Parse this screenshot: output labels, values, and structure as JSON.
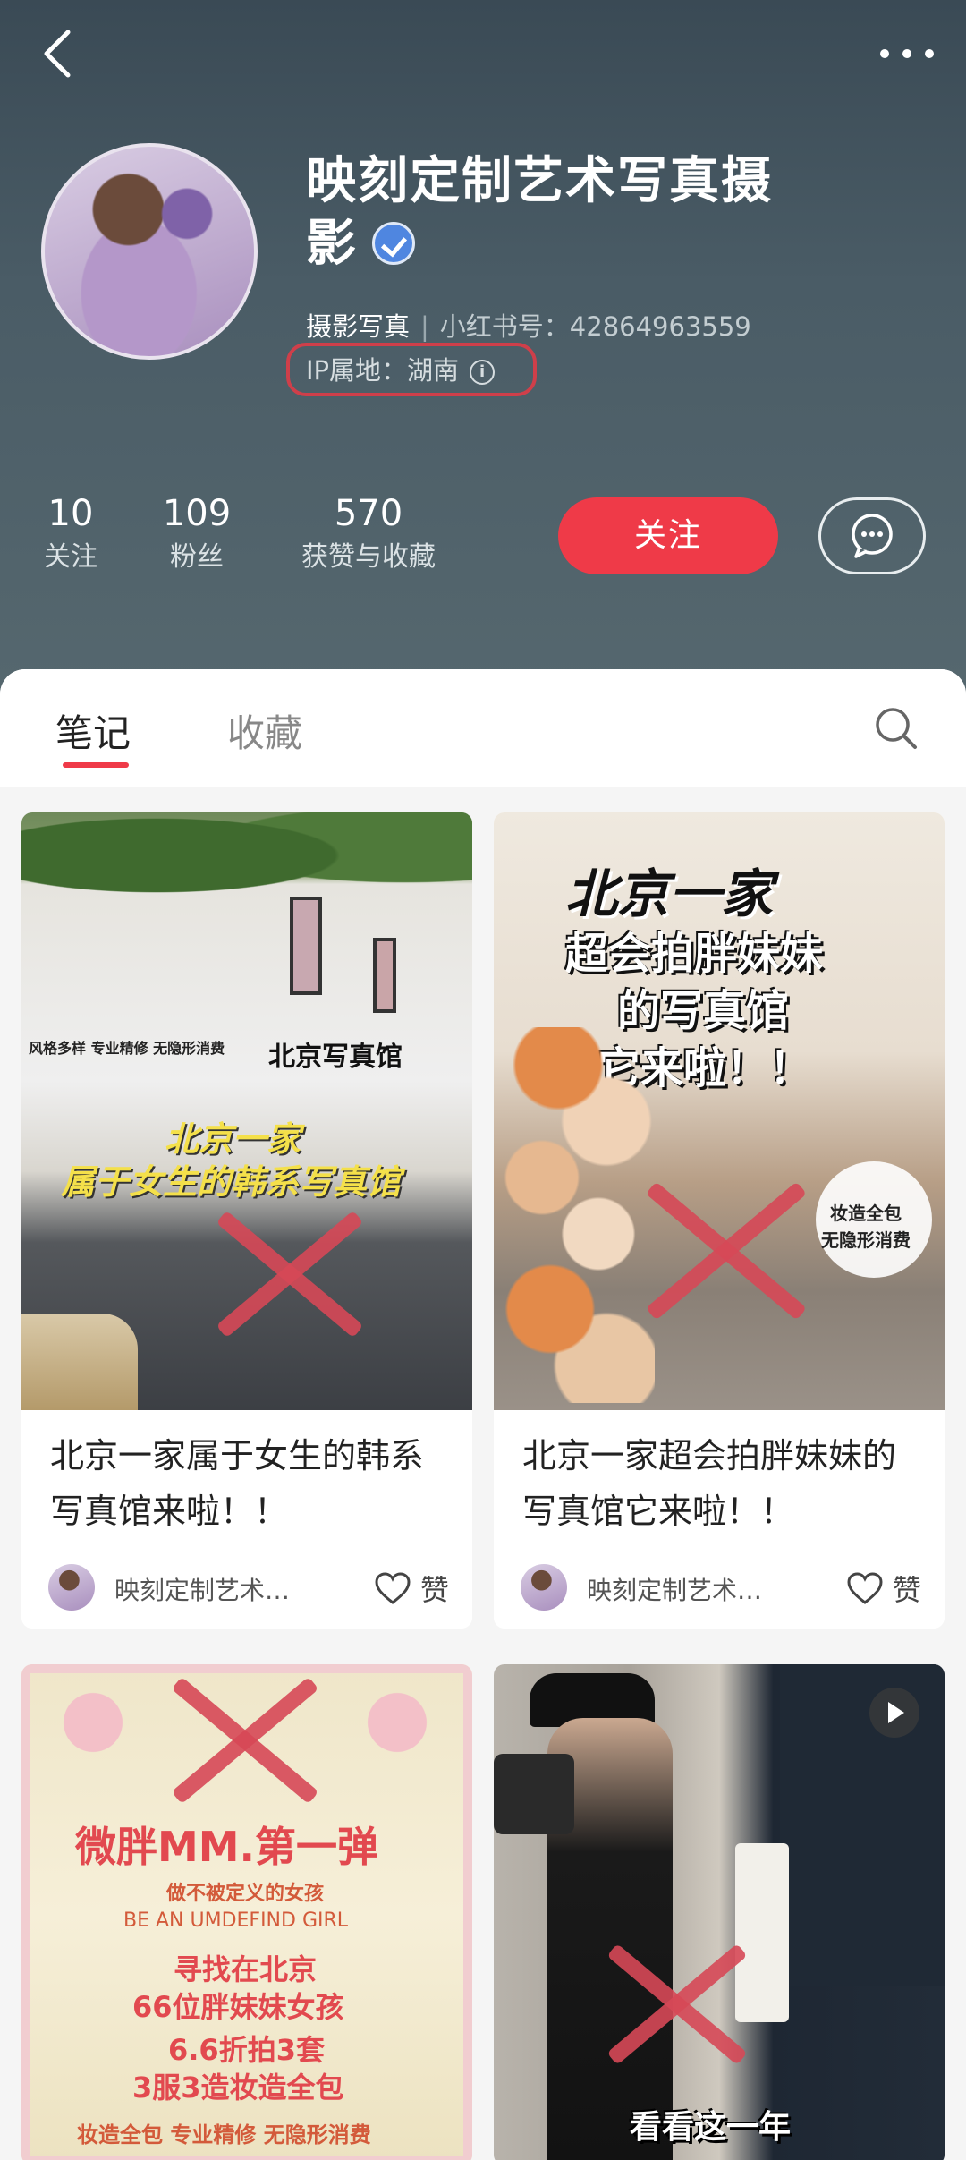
{
  "profile": {
    "name": "映刻定制艺术写真摄影",
    "category": "摄影写真",
    "id_text": "小红书号：42864963559",
    "ip_text": "IP属地：湖南",
    "info_glyph": "i"
  },
  "stats": [
    {
      "num": "10",
      "label": "关注"
    },
    {
      "num": "109",
      "label": "粉丝"
    },
    {
      "num": "570",
      "label": "获赞与收藏"
    }
  ],
  "actions": {
    "follow_label": "关注"
  },
  "tabs": {
    "notes": "笔记",
    "collections": "收藏"
  },
  "notes": [
    {
      "title": "北京一家属于女生的韩系写真馆来啦！！",
      "author": "映刻定制艺术…",
      "like_label": "赞",
      "overlay": {
        "line1": "北京一家",
        "line2": "属于女生的韩系写真馆",
        "sign": "北京写真馆",
        "banner": "风格多样 专业精修 无隐形消费"
      }
    },
    {
      "title": "北京一家超会拍胖妹妹的写真馆它来啦！！",
      "author": "映刻定制艺术…",
      "like_label": "赞",
      "overlay": {
        "line1": "北京一家",
        "line2": "超会拍胖妹妹",
        "line3": "的写真馆",
        "line4": "它来啦！！",
        "badge1": "妆造全包",
        "badge2": "无隐形消费"
      }
    },
    {
      "overlay": {
        "line1": "微胖MM.第一弹",
        "line2": "做不被定义的女孩",
        "line3": "BE AN UMDEFIND GIRL",
        "line4": "寻找在北京",
        "line5": "66位胖妹妹女孩",
        "line6": "6.6折拍3套",
        "line7": "3服3造妆造全包",
        "line8": "妆造全包 专业精修 无隐形消费"
      }
    },
    {
      "overlay": {
        "caption": "看看这一年"
      }
    }
  ],
  "colors": {
    "accent": "#ef3a48",
    "header": "#4a5c66"
  }
}
